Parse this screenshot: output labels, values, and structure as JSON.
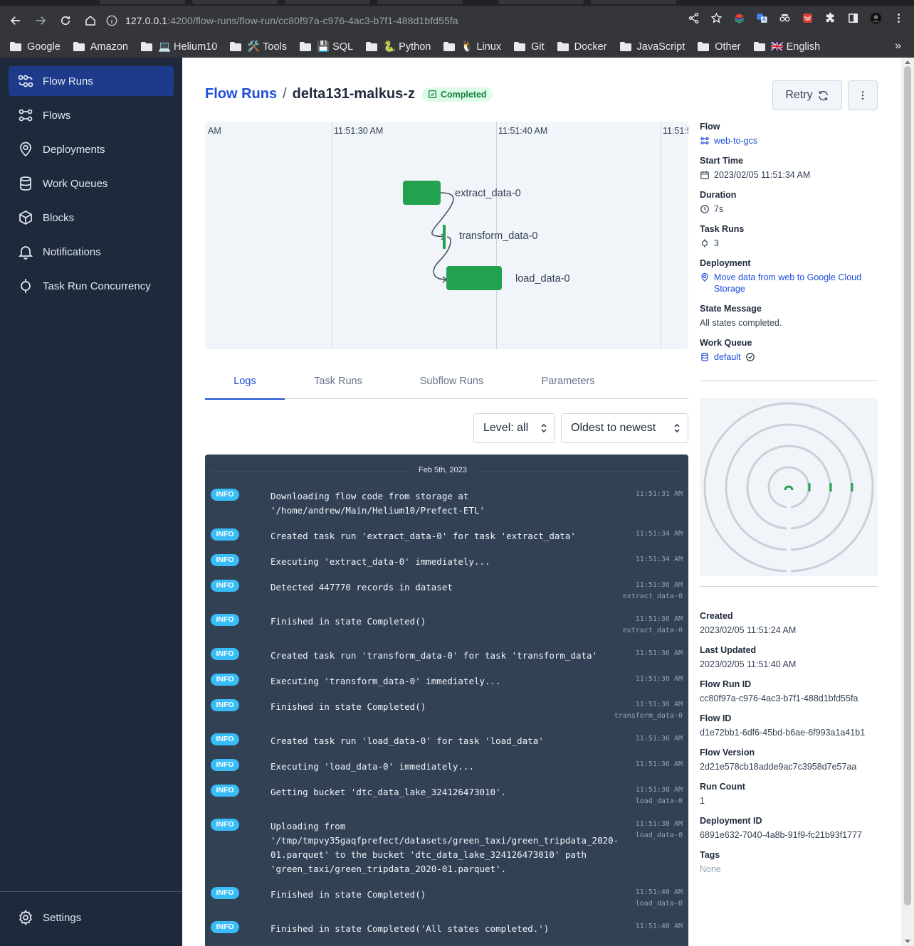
{
  "browser": {
    "url_host": "127.0.0.1",
    "url_rest": ":4200/flow-runs/flow-run/cc80f97a-c976-4ac3-b7f1-488d1bfd55fa",
    "bookmarks": [
      "Google",
      "Amazon",
      "💻 Helium10",
      "🛠️ Tools",
      "💾 SQL",
      "🐍 Python",
      "🐧 Linux",
      "Git",
      "Docker",
      "JavaScript",
      "Other",
      "🇬🇧 English"
    ],
    "bookmarks_more": "»"
  },
  "sidebar": {
    "items": [
      {
        "label": "Flow Runs",
        "icon": "flow-runs-icon"
      },
      {
        "label": "Flows",
        "icon": "flows-icon"
      },
      {
        "label": "Deployments",
        "icon": "deployments-icon"
      },
      {
        "label": "Work Queues",
        "icon": "work-queues-icon"
      },
      {
        "label": "Blocks",
        "icon": "blocks-icon"
      },
      {
        "label": "Notifications",
        "icon": "bell-icon"
      },
      {
        "label": "Task Run Concurrency",
        "icon": "concurrency-icon"
      }
    ],
    "settings_label": "Settings"
  },
  "header": {
    "crumb_link": "Flow Runs",
    "crumb_sep": "/",
    "run_name": "delta131-malkus-z",
    "status": "Completed",
    "retry_label": "Retry"
  },
  "timeline": {
    "ticks": [
      "AM",
      "11:51:30 AM",
      "11:51:40 AM",
      "11:51:5"
    ],
    "tasks": [
      "extract_data-0",
      "transform_data-0",
      "load_data-0"
    ]
  },
  "tabs": [
    "Logs",
    "Task Runs",
    "Subflow Runs",
    "Parameters"
  ],
  "filters": {
    "level": "Level: all",
    "order": "Oldest to newest"
  },
  "logs": {
    "date": "Feb 5th, 2023",
    "rows": [
      {
        "level": "INFO",
        "message": "Downloading flow code from storage at '/home/andrew/Main/Helium10/Prefect-ETL'",
        "time": "11:51:31 AM",
        "task": ""
      },
      {
        "level": "INFO",
        "message": "Created task run 'extract_data-0' for task 'extract_data'",
        "time": "11:51:34 AM",
        "task": ""
      },
      {
        "level": "INFO",
        "message": "Executing 'extract_data-0' immediately...",
        "time": "11:51:34 AM",
        "task": ""
      },
      {
        "level": "INFO",
        "message": "Detected 447770 records in dataset",
        "time": "11:51:36 AM",
        "task": "extract_data-0"
      },
      {
        "level": "INFO",
        "message": "Finished in state Completed()",
        "time": "11:51:36 AM",
        "task": "extract_data-0"
      },
      {
        "level": "INFO",
        "message": "Created task run 'transform_data-0' for task 'transform_data'",
        "time": "11:51:36 AM",
        "task": ""
      },
      {
        "level": "INFO",
        "message": "Executing 'transform_data-0' immediately...",
        "time": "11:51:36 AM",
        "task": ""
      },
      {
        "level": "INFO",
        "message": "Finished in state Completed()",
        "time": "11:51:36 AM",
        "task": "transform_data-0"
      },
      {
        "level": "INFO",
        "message": "Created task run 'load_data-0' for task 'load_data'",
        "time": "11:51:36 AM",
        "task": ""
      },
      {
        "level": "INFO",
        "message": "Executing 'load_data-0' immediately...",
        "time": "11:51:36 AM",
        "task": ""
      },
      {
        "level": "INFO",
        "message": "Getting bucket 'dtc_data_lake_324126473010'.",
        "time": "11:51:38 AM",
        "task": "load_data-0"
      },
      {
        "level": "INFO",
        "message": "Uploading from '/tmp/tmpvy35gaqfprefect/datasets/green_taxi/green_tripdata_2020-01.parquet' to the bucket 'dtc_data_lake_324126473010' path 'green_taxi/green_tripdata_2020-01.parquet'.",
        "time": "11:51:38 AM",
        "task": "load_data-0"
      },
      {
        "level": "INFO",
        "message": "Finished in state Completed()",
        "time": "11:51:40 AM",
        "task": "load_data-0"
      },
      {
        "level": "INFO",
        "message": "Finished in state Completed('All states completed.')",
        "time": "11:51:40 AM",
        "task": ""
      }
    ]
  },
  "details": {
    "flow_label": "Flow",
    "flow_value": "web-to-gcs",
    "start_label": "Start Time",
    "start_value": "2023/02/05 11:51:34 AM",
    "duration_label": "Duration",
    "duration_value": "7s",
    "taskruns_label": "Task Runs",
    "taskruns_value": "3",
    "deployment_label": "Deployment",
    "deployment_value_1": "Move data from web to Google Cloud",
    "deployment_value_2": "Storage",
    "state_msg_label": "State Message",
    "state_msg_value": "All states completed.",
    "work_queue_label": "Work Queue",
    "work_queue_value": "default",
    "created_label": "Created",
    "created_value": "2023/02/05 11:51:24 AM",
    "updated_label": "Last Updated",
    "updated_value": "2023/02/05 11:51:40 AM",
    "run_id_label": "Flow Run ID",
    "run_id_value": "cc80f97a-c976-4ac3-b7f1-488d1bfd55fa",
    "flow_id_label": "Flow ID",
    "flow_id_value": "d1e72bb1-6df6-45bd-b6ae-6f993a1a41b1",
    "version_label": "Flow Version",
    "version_value": "2d21e578cb18adde9ac7c3958d7e57aa",
    "run_count_label": "Run Count",
    "run_count_value": "1",
    "deployment_id_label": "Deployment ID",
    "deployment_id_value": "6891e632-7040-4a8b-91f9-fc21b93f1777",
    "tags_label": "Tags",
    "tags_value": "None"
  },
  "colors": {
    "accent": "#1d4ed8",
    "completed": "#22a24f",
    "sidebar": "#1e293b",
    "info_badge": "#38bdf8"
  }
}
